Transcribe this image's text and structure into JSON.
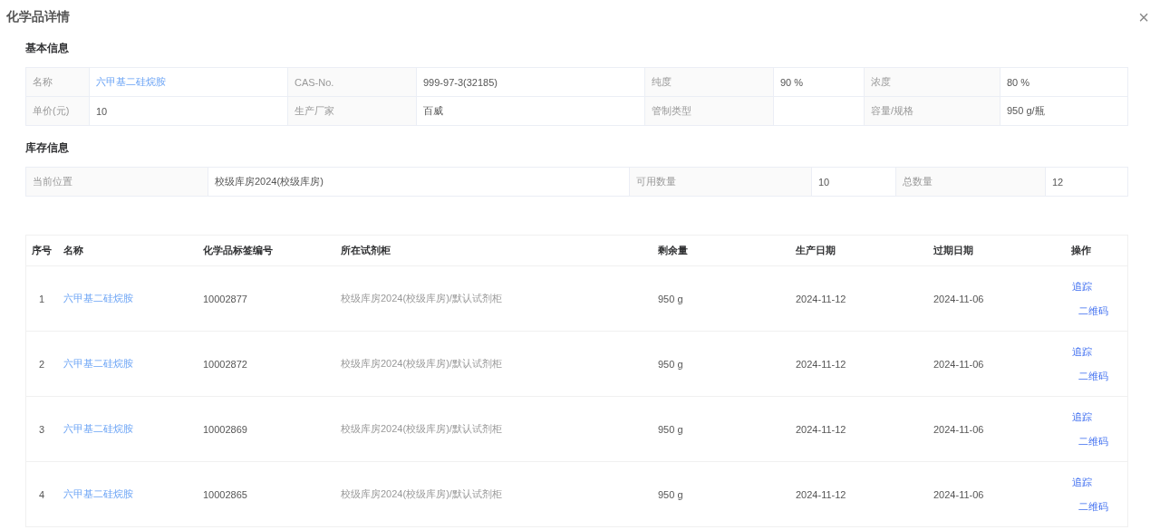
{
  "dialog": {
    "title": "化学品详情",
    "close": "×"
  },
  "basic": {
    "title": "基本信息",
    "rows": [
      [
        {
          "label": "名称",
          "value": "六甲基二硅烷胺",
          "kind": "link"
        },
        {
          "label": "CAS-No.",
          "value": "999-97-3(32185)",
          "kind": "text"
        },
        {
          "label": "纯度",
          "value": "90 %",
          "kind": "text"
        },
        {
          "label": "浓度",
          "value": "80 %",
          "kind": "text"
        }
      ],
      [
        {
          "label": "单价(元)",
          "value": "10",
          "kind": "text"
        },
        {
          "label": "生产厂家",
          "value": "百威",
          "kind": "text"
        },
        {
          "label": "管制类型",
          "kind": "text"
        },
        {
          "label": "容量/规格",
          "value": "950 g/瓶",
          "kind": "text"
        }
      ]
    ]
  },
  "stock": {
    "title": "库存信息",
    "fields": [
      {
        "label": "当前位置",
        "value": "校级库房2024(校级库房)"
      },
      {
        "label": "可用数量",
        "value": "10"
      },
      {
        "label": "总数量",
        "value": "12"
      }
    ]
  },
  "table": {
    "columns": [
      "序号",
      "名称",
      "化学品标签编号",
      "所在试剂柜",
      "剩余量",
      "生产日期",
      "过期日期",
      "操作"
    ],
    "rows": [
      {
        "index": "1",
        "name": "六甲基二硅烷胺",
        "label_no": "10002877",
        "cabinet": "校级库房2024(校级库房)/默认试剂柜",
        "remaining": "950 g",
        "produced": "2024-11-12",
        "expires": "2024-11-06",
        "actions": [
          "追踪",
          "二维码"
        ]
      },
      {
        "index": "2",
        "name": "六甲基二硅烷胺",
        "label_no": "10002872",
        "cabinet": "校级库房2024(校级库房)/默认试剂柜",
        "remaining": "950 g",
        "produced": "2024-11-12",
        "expires": "2024-11-06",
        "actions": [
          "追踪",
          "二维码"
        ]
      },
      {
        "index": "3",
        "name": "六甲基二硅烷胺",
        "label_no": "10002869",
        "cabinet": "校级库房2024(校级库房)/默认试剂柜",
        "remaining": "950 g",
        "produced": "2024-11-12",
        "expires": "2024-11-06",
        "actions": [
          "追踪",
          "二维码"
        ]
      },
      {
        "index": "4",
        "name": "六甲基二硅烷胺",
        "label_no": "10002865",
        "cabinet": "校级库房2024(校级库房)/默认试剂柜",
        "remaining": "950 g",
        "produced": "2024-11-12",
        "expires": "2024-11-06",
        "actions": [
          "追踪",
          "二维码"
        ]
      }
    ]
  }
}
